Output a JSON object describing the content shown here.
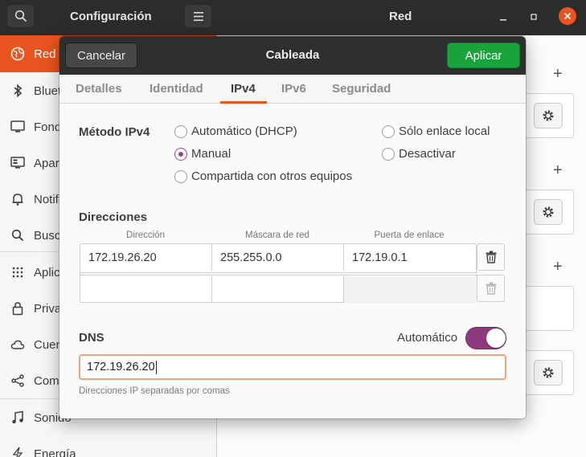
{
  "settings": {
    "left_title": "Configuración",
    "right_title": "Red",
    "icons": {
      "search": "search-icon",
      "menu": "hamburger-menu-icon",
      "minimize": "minimize-icon",
      "maximize": "maximize-icon",
      "close": "close-icon"
    },
    "accent_color": "#e95420"
  },
  "sidebar": {
    "items": [
      {
        "label": "Red",
        "icon": "network-globe-icon",
        "active": true
      },
      {
        "label": "Blueto",
        "icon": "bluetooth-icon"
      },
      {
        "label": "Fondo",
        "icon": "background-display-icon"
      },
      {
        "label": "Apari",
        "icon": "appearance-icon"
      },
      {
        "label": "Notific",
        "icon": "bell-icon"
      },
      {
        "label": "Busca",
        "icon": "search-icon"
      },
      {
        "label": "Aplica",
        "icon": "apps-grid-icon"
      },
      {
        "label": "Privac",
        "icon": "lock-icon"
      },
      {
        "label": "Cuen",
        "icon": "cloud-icon"
      },
      {
        "label": "Comp",
        "icon": "share-icon"
      },
      {
        "label": "Sonido",
        "icon": "music-note-icon"
      },
      {
        "label": "Energía",
        "icon": "power-icon"
      }
    ]
  },
  "main_panel": {
    "add_symbol": "+",
    "gear_icon": "gear-icon"
  },
  "dialog": {
    "title": "Cableada",
    "cancel_label": "Cancelar",
    "apply_label": "Aplicar",
    "tabs": [
      {
        "label": "Detalles"
      },
      {
        "label": "Identidad"
      },
      {
        "label": "IPv4",
        "active": true
      },
      {
        "label": "IPv6"
      },
      {
        "label": "Seguridad"
      }
    ],
    "method": {
      "label": "Método IPv4",
      "options": [
        {
          "label": "Automático (DHCP)",
          "checked": false
        },
        {
          "label": "Manual",
          "checked": true
        },
        {
          "label": "Compartida con otros equipos",
          "checked": false
        },
        {
          "label": "Sólo enlace local",
          "checked": false
        },
        {
          "label": "Desactivar",
          "checked": false
        }
      ]
    },
    "addresses": {
      "label": "Direcciones",
      "columns": [
        "Dirección",
        "Máscara de red",
        "Puerta de enlace"
      ],
      "rows": [
        [
          "172.19.26.20",
          "255.255.0.0",
          "172.19.0.1"
        ],
        [
          "",
          "",
          ""
        ]
      ],
      "delete_icon": "trash-icon"
    },
    "dns": {
      "label": "DNS",
      "auto_label": "Automático",
      "auto_enabled": true,
      "value": "172.19.26.20",
      "hint": "Direcciones IP separadas por comas"
    }
  }
}
